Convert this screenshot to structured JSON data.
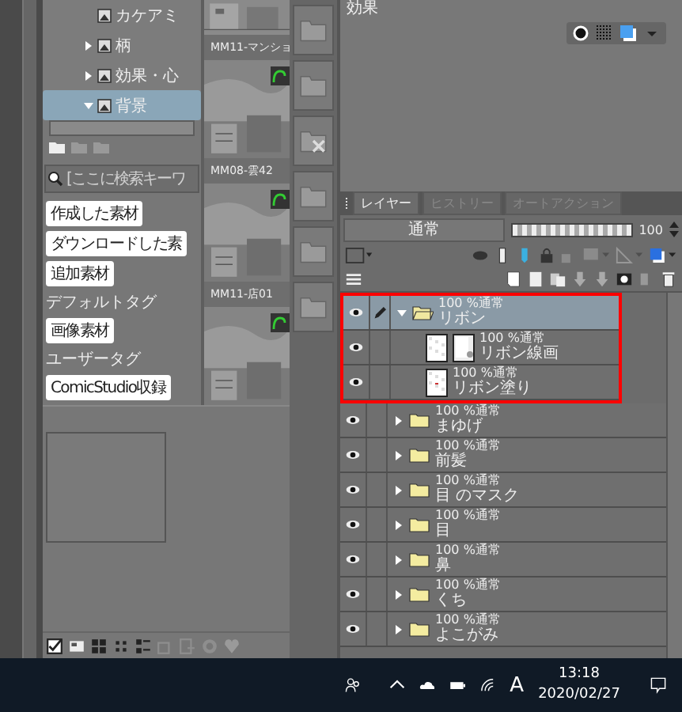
{
  "material_tree": {
    "items": [
      {
        "label": "カケアミ",
        "kind": "plain",
        "selected": false
      },
      {
        "label": "柄",
        "kind": "folder",
        "expanded": false,
        "selected": false
      },
      {
        "label": "効果・心",
        "kind": "folder",
        "expanded": false,
        "selected": false
      },
      {
        "label": "背景",
        "kind": "folder",
        "expanded": true,
        "selected": true
      }
    ]
  },
  "material_search": {
    "placeholder": "[ここに検索キーワ"
  },
  "material_tags": [
    {
      "kind": "tag",
      "label": "作成した素材"
    },
    {
      "kind": "tag",
      "label": "ダウンロードした素"
    },
    {
      "kind": "tag",
      "label": "追加素材"
    },
    {
      "kind": "heading",
      "label": "デフォルトタグ"
    },
    {
      "kind": "tag",
      "label": "画像素材"
    },
    {
      "kind": "heading",
      "label": "ユーザータグ"
    },
    {
      "kind": "tag",
      "label": "ComicStudio収録"
    }
  ],
  "material_thumbnails": [
    {
      "label": "MM11-マンショ"
    },
    {
      "label": "MM08-雲42"
    },
    {
      "label": "MM11-店01"
    }
  ],
  "effect_panel": {
    "title": "効果"
  },
  "layer_panel": {
    "tabs": [
      {
        "label": "レイヤー",
        "selected": true
      },
      {
        "label": "ヒストリー",
        "selected": false
      },
      {
        "label": "オートアクション",
        "selected": false
      }
    ],
    "blend_mode": "通常",
    "opacity": {
      "level": 1,
      "reading": "100"
    },
    "layers": [
      {
        "kind": "folder",
        "mode": "100 %通常",
        "name": "リボン",
        "expanded": true,
        "highlighted": true,
        "selected": true,
        "visible": true,
        "children": [
          {
            "kind": "masked",
            "mode": "100 %通常",
            "name": "リボン線画",
            "selected": false,
            "visible": true
          },
          {
            "kind": "raster",
            "mode": "100 %通常",
            "name": "リボン塗り",
            "selected": false,
            "visible": true
          }
        ]
      },
      {
        "kind": "folder",
        "mode": "100 %通常",
        "name": "まゆげ",
        "expanded": false,
        "highlighted": false,
        "selected": false,
        "visible": true
      },
      {
        "kind": "folder",
        "mode": "100 %通常",
        "name": "前髪",
        "expanded": false,
        "highlighted": false,
        "selected": false,
        "visible": true
      },
      {
        "kind": "folder",
        "mode": "100 %通常",
        "name": "目 のマスク",
        "expanded": false,
        "highlighted": false,
        "selected": false,
        "visible": true
      },
      {
        "kind": "folder",
        "mode": "100 %通常",
        "name": "目",
        "expanded": false,
        "highlighted": false,
        "selected": false,
        "visible": true
      },
      {
        "kind": "folder",
        "mode": "100 %通常",
        "name": "鼻",
        "expanded": false,
        "highlighted": false,
        "selected": false,
        "visible": true
      },
      {
        "kind": "folder",
        "mode": "100 %通常",
        "name": "くち",
        "expanded": false,
        "highlighted": false,
        "selected": false,
        "visible": true
      },
      {
        "kind": "folder",
        "mode": "100 %通常",
        "name": "よこがみ",
        "expanded": false,
        "highlighted": false,
        "selected": false,
        "visible": true
      }
    ]
  },
  "taskbar": {
    "ime": "A",
    "time": "13:18",
    "date": "2020/02/27"
  }
}
